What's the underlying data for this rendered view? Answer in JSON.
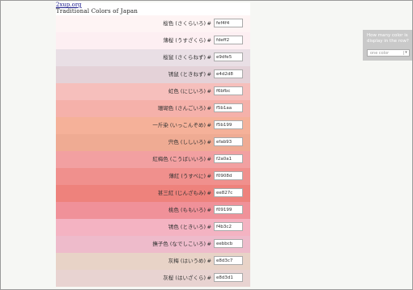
{
  "site": {
    "link_text": "2xup.org"
  },
  "page": {
    "title": "Traditional Colors of Japan"
  },
  "hash_symbol": "#",
  "rows": [
    {
      "name": "桜色 (さくらいろ)",
      "hex": "fef4f4",
      "color": "#fef4f4"
    },
    {
      "name": "薄桜 (うすざくら)",
      "hex": "fdeff2",
      "color": "#fdeff2"
    },
    {
      "name": "桜鼠 (さくらねず)",
      "hex": "e9dfe5",
      "color": "#e9dfe5"
    },
    {
      "name": "鴇鼠 (ときねず)",
      "hex": "e4d2d8",
      "color": "#e4d2d8"
    },
    {
      "name": "虹色 (にじいろ)",
      "hex": "f6bfbc",
      "color": "#f6bfbc"
    },
    {
      "name": "珊瑚色 (さんごいろ)",
      "hex": "f5b1aa",
      "color": "#f5b1aa"
    },
    {
      "name": "一斤染 (いっこんぞめ)",
      "hex": "f5b199",
      "color": "#f5b199"
    },
    {
      "name": "宍色 (ししいろ)",
      "hex": "efab93",
      "color": "#efab93"
    },
    {
      "name": "紅梅色 (こうばいいろ)",
      "hex": "f2a0a1",
      "color": "#f2a0a1"
    },
    {
      "name": "薄紅 (うすべに)",
      "hex": "f0908d",
      "color": "#f0908d"
    },
    {
      "name": "甚三紅 (じんざもみ)",
      "hex": "ee827c",
      "color": "#ee827c"
    },
    {
      "name": "桃色 (ももいろ)",
      "hex": "f09199",
      "color": "#f09199"
    },
    {
      "name": "鴇色 (ときいろ)",
      "hex": "f4b3c2",
      "color": "#f4b3c2"
    },
    {
      "name": "撫子色 (なでしこいろ)",
      "hex": "eebbcb",
      "color": "#eebbcb"
    },
    {
      "name": "灰梅 (はいうめ)",
      "hex": "e8d3c7",
      "color": "#e8d3c7"
    },
    {
      "name": "灰桜 (はいざくら)",
      "hex": "e8d3d1",
      "color": "#e8d3d1"
    }
  ],
  "side_panel": {
    "question": "How many color is display in the row?",
    "select_value": "one color",
    "chevron": "▾"
  }
}
